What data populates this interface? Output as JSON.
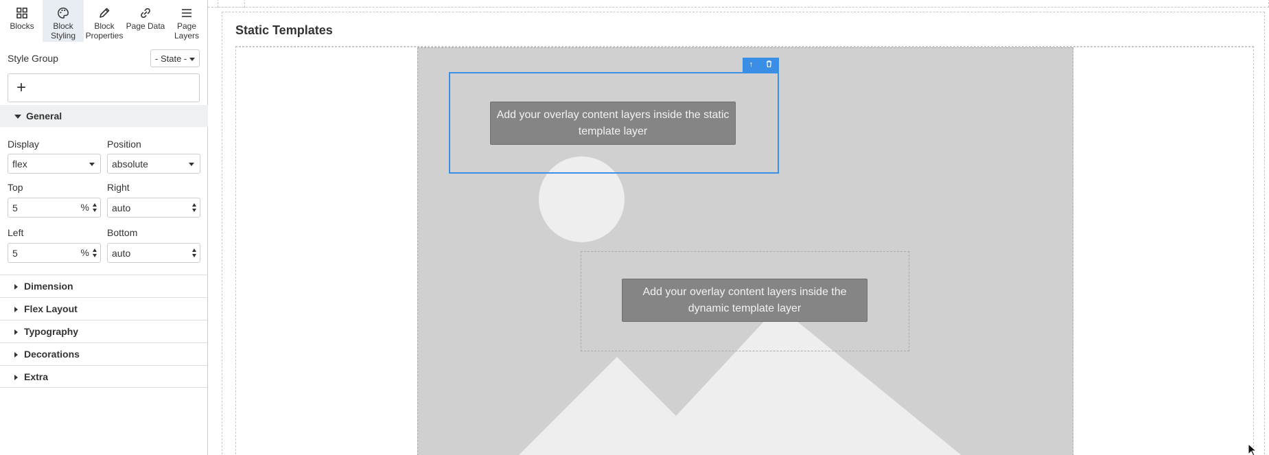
{
  "toolbar": {
    "items": [
      {
        "label": "Blocks",
        "icon": "grid-icon"
      },
      {
        "label": "Block Styling",
        "icon": "palette-icon"
      },
      {
        "label": "Block Properties",
        "icon": "pencil-icon"
      },
      {
        "label": "Page Data",
        "icon": "link-icon"
      },
      {
        "label": "Page Layers",
        "icon": "menu-icon"
      }
    ]
  },
  "panel": {
    "style_group_label": "Style Group",
    "state_value": "- State -",
    "add_symbol": "+",
    "general_label": "General",
    "display_label": "Display",
    "display_value": "flex",
    "position_label": "Position",
    "position_value": "absolute",
    "top_label": "Top",
    "top_value": "5",
    "top_unit": "%",
    "right_label": "Right",
    "right_value": "auto",
    "left_label": "Left",
    "left_value": "5",
    "left_unit": "%",
    "bottom_label": "Bottom",
    "bottom_value": "auto",
    "sections": [
      "Dimension",
      "Flex Layout",
      "Typography",
      "Decorations",
      "Extra"
    ]
  },
  "canvas": {
    "title": "Static Templates",
    "static_overlay_text": "Add your overlay content layers inside the static template layer",
    "dynamic_overlay_text": "Add your overlay content layers inside the dynamic template layer",
    "actions": {
      "move_up": "↑",
      "delete": "🗑"
    },
    "colors": {
      "accent": "#3a8ee6",
      "placeholder_bg": "#d0d0d0",
      "overlay_bg": "#858585"
    }
  }
}
